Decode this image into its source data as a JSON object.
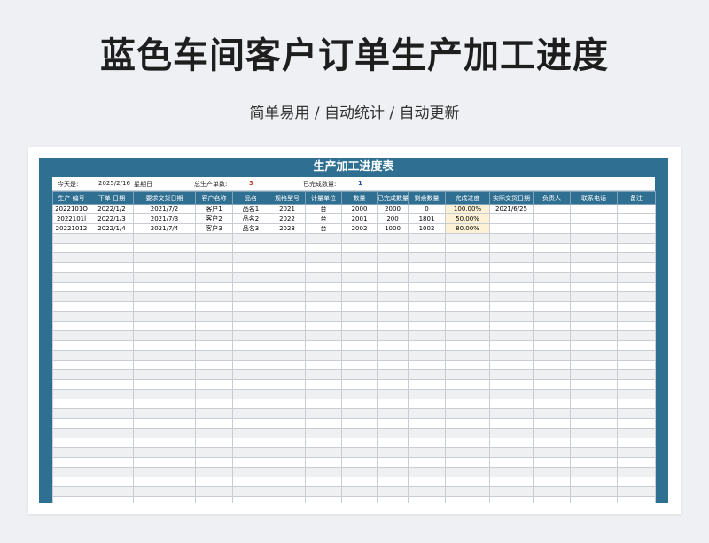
{
  "page": {
    "title": "蓝色车间客户订单生产加工进度",
    "subtitle": "简单易用 / 自动统计 / 自动更新"
  },
  "sheet": {
    "title": "生产加工进度表",
    "info": {
      "today_label": "今天是:",
      "today_value": "2025/2/16",
      "weekday": "星期日",
      "total_label": "总生产单数:",
      "total_value": "3",
      "done_label": "已完成数量:",
      "done_value": "1"
    },
    "headers": [
      "生产 编号",
      "下单 日期",
      "要求交货日期",
      "客户名称",
      "品名",
      "规格型号",
      "计量单位",
      "数量",
      "已完成数量",
      "剩余数量",
      "完成进度",
      "实际交货日期",
      "负责人",
      "联系电话",
      "备注"
    ],
    "rows": [
      [
        "2022101O",
        "2022/1/2",
        "2021/7/2",
        "客户1",
        "品名1",
        "2021",
        "台",
        "2000",
        "2000",
        "0",
        "100.00%",
        "2021/6/25",
        "",
        "",
        ""
      ],
      [
        "2022101l",
        "2022/1/3",
        "2021/7/3",
        "客户2",
        "品名2",
        "2022",
        "台",
        "2001",
        "200",
        "1801",
        "50.00%",
        "",
        "",
        "",
        ""
      ],
      [
        "20221012",
        "2022/1/4",
        "2021/7/4",
        "客户3",
        "品名3",
        "2023",
        "台",
        "2002",
        "1000",
        "1002",
        "80.00%",
        "",
        "",
        "",
        ""
      ]
    ],
    "empty_rows": 30
  }
}
